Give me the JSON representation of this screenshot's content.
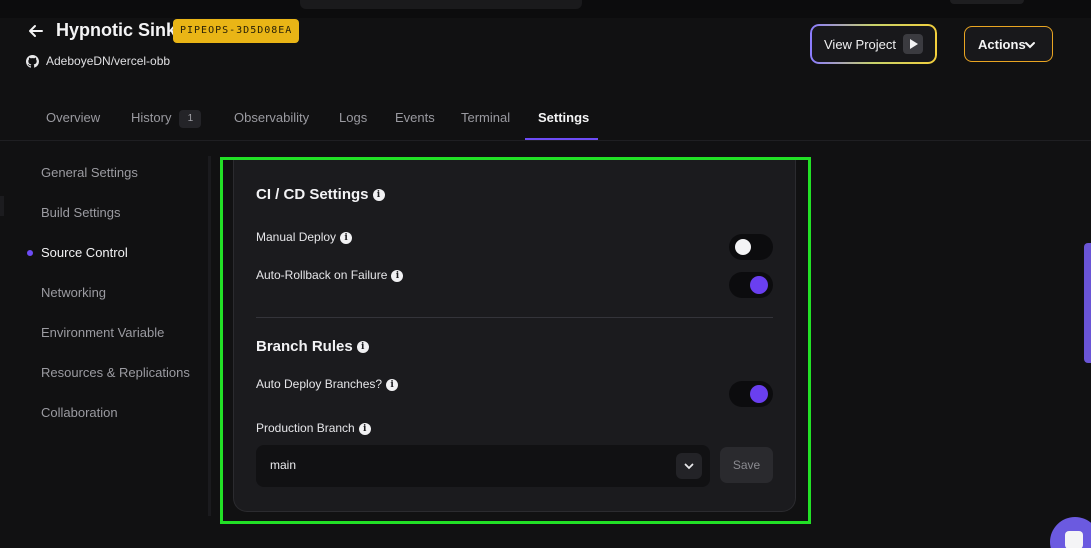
{
  "header": {
    "title": "Hypnotic Sink",
    "badge": "PIPEOPS-3D5D08EA",
    "repo": "AdeboyeDN/vercel-obb",
    "view_project_label": "View Project",
    "actions_label": "Actions"
  },
  "tabs": [
    {
      "label": "Overview"
    },
    {
      "label": "History",
      "count": "1"
    },
    {
      "label": "Observability"
    },
    {
      "label": "Logs"
    },
    {
      "label": "Events"
    },
    {
      "label": "Terminal"
    },
    {
      "label": "Settings",
      "active": true
    }
  ],
  "sidebar": {
    "items": [
      {
        "label": "General Settings"
      },
      {
        "label": "Build Settings"
      },
      {
        "label": "Source Control",
        "active": true
      },
      {
        "label": "Networking"
      },
      {
        "label": "Environment Variable"
      },
      {
        "label": "Resources & Replications"
      },
      {
        "label": "Collaboration"
      }
    ]
  },
  "cicd": {
    "title": "CI / CD Settings",
    "manual_deploy": {
      "label": "Manual Deploy",
      "enabled": false
    },
    "auto_rollback": {
      "label": "Auto-Rollback on Failure",
      "enabled": true
    }
  },
  "branch_rules": {
    "title": "Branch Rules",
    "auto_deploy": {
      "label": "Auto Deploy Branches?",
      "enabled": true
    },
    "production_branch_label": "Production Branch",
    "production_branch_value": "main",
    "save_label": "Save"
  },
  "colors": {
    "accent": "#6d4cf5",
    "badge": "#e9b516",
    "actions_border": "#e9a522",
    "highlight": "#22e026"
  },
  "icons": {
    "back": "arrow-left-icon",
    "github": "github-icon",
    "play": "play-icon",
    "chevron": "chevron-down-icon",
    "info": "info-icon",
    "chat": "chat-icon"
  }
}
